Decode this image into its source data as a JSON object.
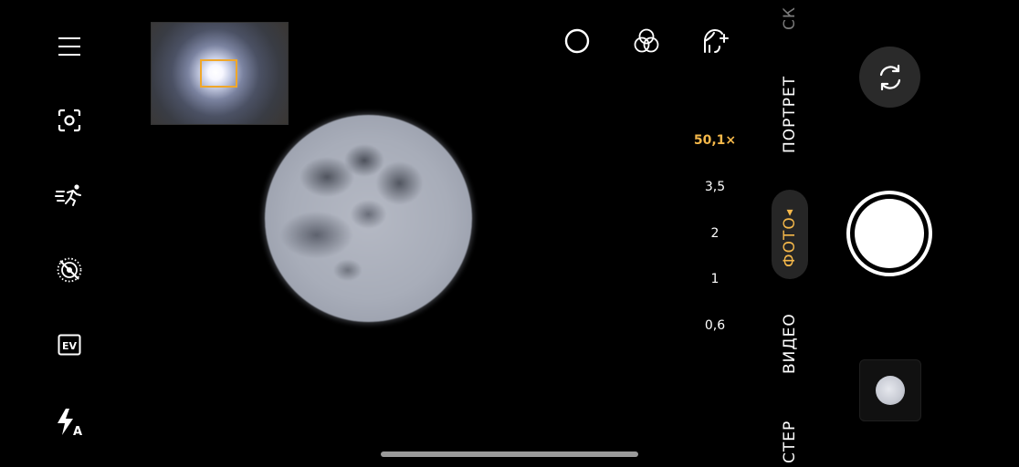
{
  "left_toolbar": {
    "items": [
      {
        "icon": "menu-icon"
      },
      {
        "icon": "focus-icon"
      },
      {
        "icon": "motion-icon"
      },
      {
        "icon": "live-off-icon"
      },
      {
        "icon": "ev-icon",
        "label": "EV"
      },
      {
        "icon": "flash-auto-icon",
        "label": "A"
      }
    ]
  },
  "top_icons": [
    {
      "icon": "circle-icon"
    },
    {
      "icon": "filters-icon"
    },
    {
      "icon": "beauty-icon"
    }
  ],
  "zoom": {
    "levels": [
      "50,1×",
      "3,5",
      "2",
      "1",
      "0,6"
    ],
    "active": "50,1×"
  },
  "modes": {
    "items": [
      "СК",
      "ПОРТРЕТ",
      "ФОТО",
      "ВИДЕО",
      "СТЕР"
    ],
    "active": "ФОТО",
    "caret": "▲"
  },
  "colors": {
    "accent": "#f5b84a",
    "minimap_frame": "#f0a72a",
    "background": "#000000"
  }
}
